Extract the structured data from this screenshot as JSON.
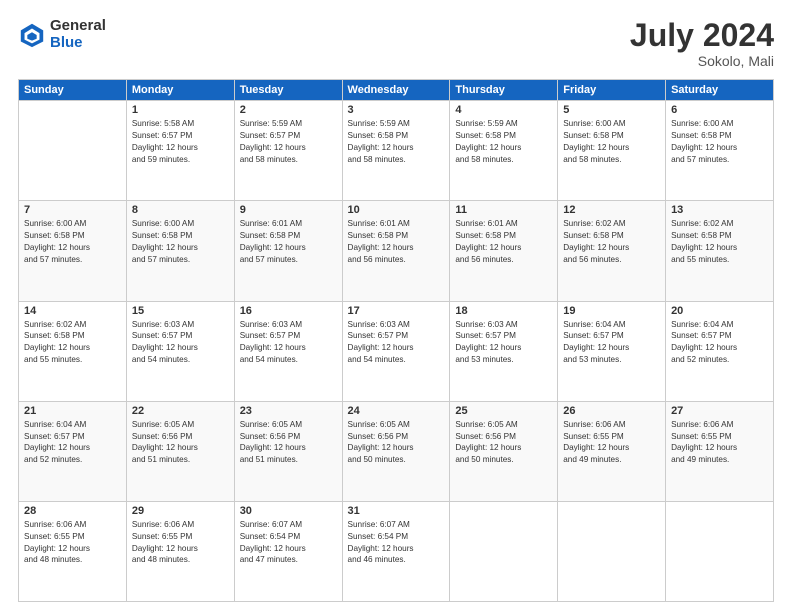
{
  "logo": {
    "general": "General",
    "blue": "Blue"
  },
  "header": {
    "title": "July 2024",
    "location": "Sokolo, Mali"
  },
  "weekdays": [
    "Sunday",
    "Monday",
    "Tuesday",
    "Wednesday",
    "Thursday",
    "Friday",
    "Saturday"
  ],
  "weeks": [
    [
      {
        "day": "",
        "info": ""
      },
      {
        "day": "1",
        "info": "Sunrise: 5:58 AM\nSunset: 6:57 PM\nDaylight: 12 hours\nand 59 minutes."
      },
      {
        "day": "2",
        "info": "Sunrise: 5:59 AM\nSunset: 6:57 PM\nDaylight: 12 hours\nand 58 minutes."
      },
      {
        "day": "3",
        "info": "Sunrise: 5:59 AM\nSunset: 6:58 PM\nDaylight: 12 hours\nand 58 minutes."
      },
      {
        "day": "4",
        "info": "Sunrise: 5:59 AM\nSunset: 6:58 PM\nDaylight: 12 hours\nand 58 minutes."
      },
      {
        "day": "5",
        "info": "Sunrise: 6:00 AM\nSunset: 6:58 PM\nDaylight: 12 hours\nand 58 minutes."
      },
      {
        "day": "6",
        "info": "Sunrise: 6:00 AM\nSunset: 6:58 PM\nDaylight: 12 hours\nand 57 minutes."
      }
    ],
    [
      {
        "day": "7",
        "info": "Sunrise: 6:00 AM\nSunset: 6:58 PM\nDaylight: 12 hours\nand 57 minutes."
      },
      {
        "day": "8",
        "info": "Sunrise: 6:00 AM\nSunset: 6:58 PM\nDaylight: 12 hours\nand 57 minutes."
      },
      {
        "day": "9",
        "info": "Sunrise: 6:01 AM\nSunset: 6:58 PM\nDaylight: 12 hours\nand 57 minutes."
      },
      {
        "day": "10",
        "info": "Sunrise: 6:01 AM\nSunset: 6:58 PM\nDaylight: 12 hours\nand 56 minutes."
      },
      {
        "day": "11",
        "info": "Sunrise: 6:01 AM\nSunset: 6:58 PM\nDaylight: 12 hours\nand 56 minutes."
      },
      {
        "day": "12",
        "info": "Sunrise: 6:02 AM\nSunset: 6:58 PM\nDaylight: 12 hours\nand 56 minutes."
      },
      {
        "day": "13",
        "info": "Sunrise: 6:02 AM\nSunset: 6:58 PM\nDaylight: 12 hours\nand 55 minutes."
      }
    ],
    [
      {
        "day": "14",
        "info": "Sunrise: 6:02 AM\nSunset: 6:58 PM\nDaylight: 12 hours\nand 55 minutes."
      },
      {
        "day": "15",
        "info": "Sunrise: 6:03 AM\nSunset: 6:57 PM\nDaylight: 12 hours\nand 54 minutes."
      },
      {
        "day": "16",
        "info": "Sunrise: 6:03 AM\nSunset: 6:57 PM\nDaylight: 12 hours\nand 54 minutes."
      },
      {
        "day": "17",
        "info": "Sunrise: 6:03 AM\nSunset: 6:57 PM\nDaylight: 12 hours\nand 54 minutes."
      },
      {
        "day": "18",
        "info": "Sunrise: 6:03 AM\nSunset: 6:57 PM\nDaylight: 12 hours\nand 53 minutes."
      },
      {
        "day": "19",
        "info": "Sunrise: 6:04 AM\nSunset: 6:57 PM\nDaylight: 12 hours\nand 53 minutes."
      },
      {
        "day": "20",
        "info": "Sunrise: 6:04 AM\nSunset: 6:57 PM\nDaylight: 12 hours\nand 52 minutes."
      }
    ],
    [
      {
        "day": "21",
        "info": "Sunrise: 6:04 AM\nSunset: 6:57 PM\nDaylight: 12 hours\nand 52 minutes."
      },
      {
        "day": "22",
        "info": "Sunrise: 6:05 AM\nSunset: 6:56 PM\nDaylight: 12 hours\nand 51 minutes."
      },
      {
        "day": "23",
        "info": "Sunrise: 6:05 AM\nSunset: 6:56 PM\nDaylight: 12 hours\nand 51 minutes."
      },
      {
        "day": "24",
        "info": "Sunrise: 6:05 AM\nSunset: 6:56 PM\nDaylight: 12 hours\nand 50 minutes."
      },
      {
        "day": "25",
        "info": "Sunrise: 6:05 AM\nSunset: 6:56 PM\nDaylight: 12 hours\nand 50 minutes."
      },
      {
        "day": "26",
        "info": "Sunrise: 6:06 AM\nSunset: 6:55 PM\nDaylight: 12 hours\nand 49 minutes."
      },
      {
        "day": "27",
        "info": "Sunrise: 6:06 AM\nSunset: 6:55 PM\nDaylight: 12 hours\nand 49 minutes."
      }
    ],
    [
      {
        "day": "28",
        "info": "Sunrise: 6:06 AM\nSunset: 6:55 PM\nDaylight: 12 hours\nand 48 minutes."
      },
      {
        "day": "29",
        "info": "Sunrise: 6:06 AM\nSunset: 6:55 PM\nDaylight: 12 hours\nand 48 minutes."
      },
      {
        "day": "30",
        "info": "Sunrise: 6:07 AM\nSunset: 6:54 PM\nDaylight: 12 hours\nand 47 minutes."
      },
      {
        "day": "31",
        "info": "Sunrise: 6:07 AM\nSunset: 6:54 PM\nDaylight: 12 hours\nand 46 minutes."
      },
      {
        "day": "",
        "info": ""
      },
      {
        "day": "",
        "info": ""
      },
      {
        "day": "",
        "info": ""
      }
    ]
  ]
}
